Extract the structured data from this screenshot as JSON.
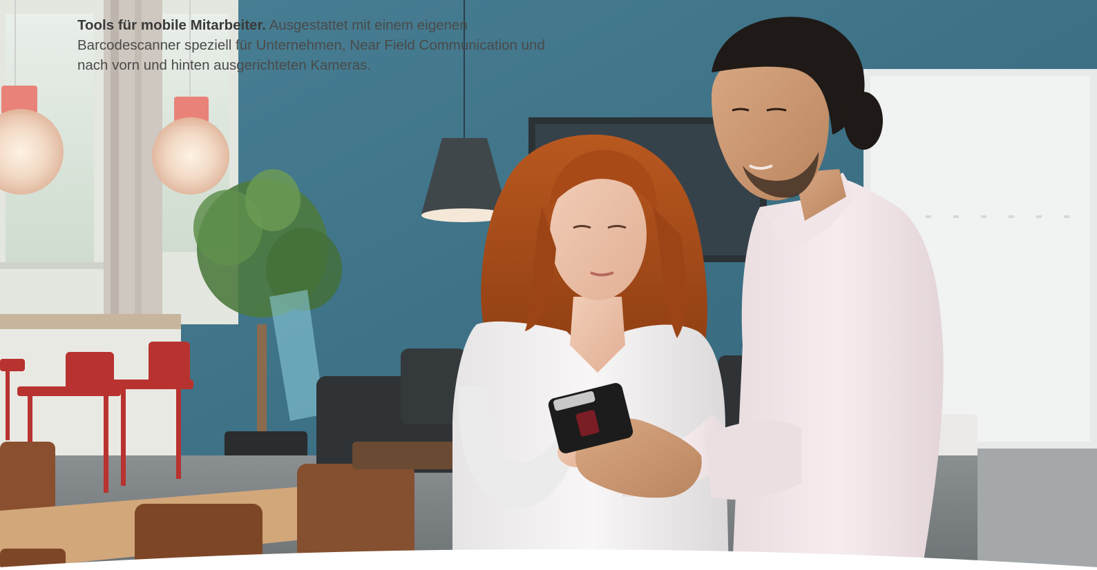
{
  "hero": {
    "image_description_alt": "",
    "caption": {
      "bold_lead": "Tools für mobile Mitarbeiter.",
      "body": " Ausgestattet mit einem eigenen Barcodescanner speziell für Unternehmen, Near Field Communication und nach vorn und hinten ausgerichteten Kameras."
    }
  },
  "colors": {
    "wall_teal": "#3d7186",
    "caption_text": "#4a4a4a",
    "chair_red": "#b8322f",
    "shirt_white": "#f4f1f0"
  },
  "icons": {
    "device": "handheld-scanner-icon"
  }
}
